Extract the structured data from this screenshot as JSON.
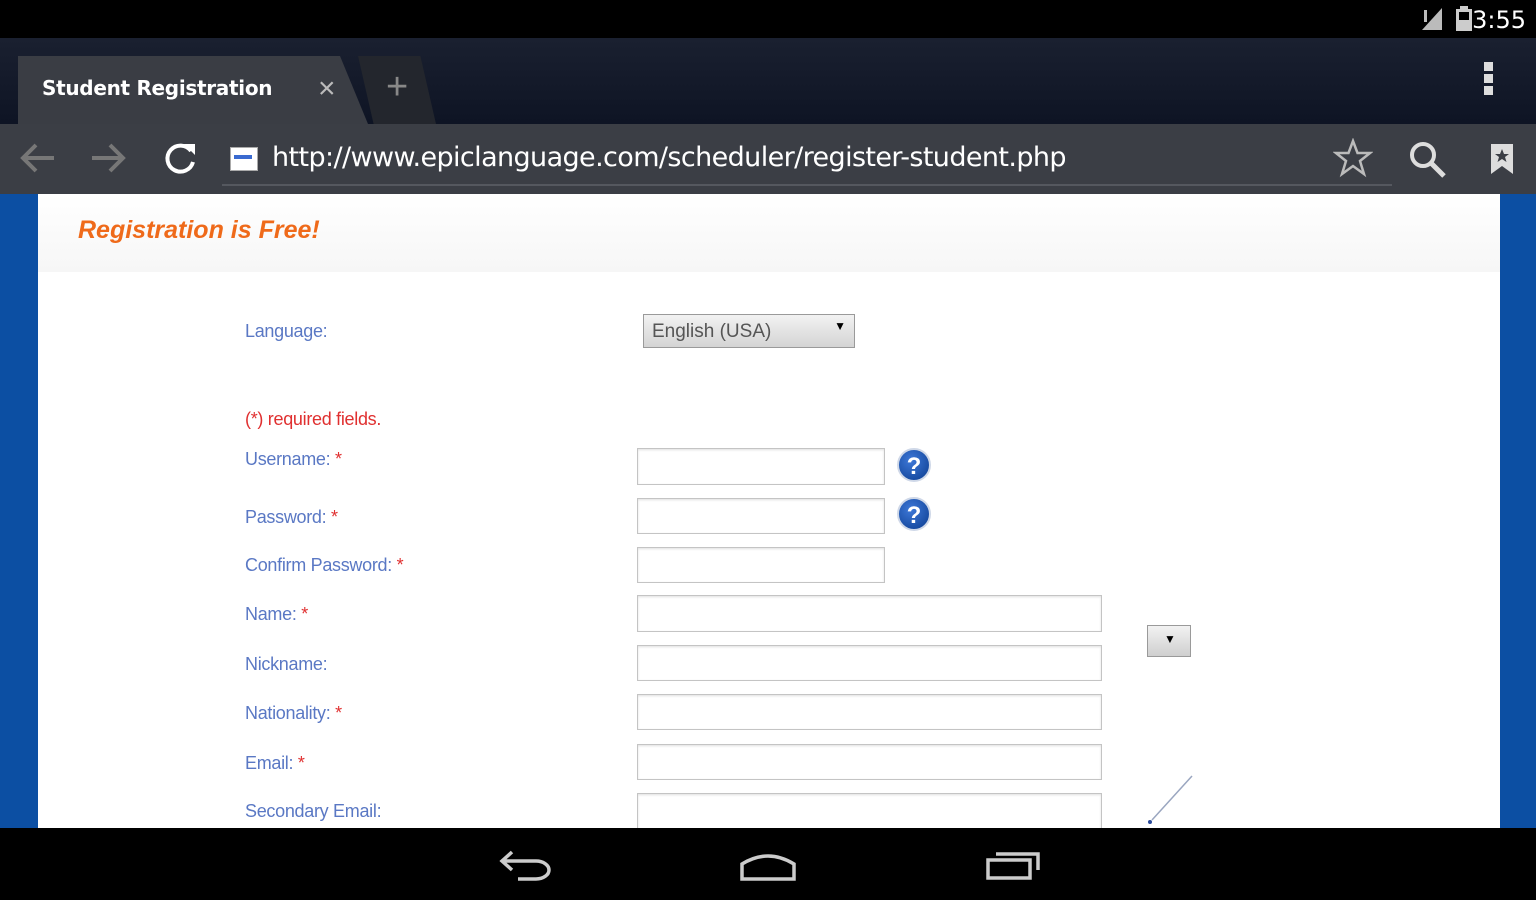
{
  "status_bar": {
    "time": "3:55"
  },
  "browser": {
    "tab_title": "Student Registration",
    "close_glyph": "×",
    "new_tab_glyph": "+",
    "url": "http://www.epiclanguage.com/scheduler/register-student.php"
  },
  "page": {
    "heading": "Registration is Free!",
    "language_label": "Language:",
    "language_value": "English (USA)",
    "required_note": "(*) required fields.",
    "fields": {
      "username": {
        "label": "Username:",
        "required": "*"
      },
      "password": {
        "label": "Password:",
        "required": "*"
      },
      "confirm_password": {
        "label": "Confirm Password:",
        "required": "*"
      },
      "name": {
        "label": "Name:",
        "required": "*"
      },
      "nickname": {
        "label": "Nickname:"
      },
      "nationality": {
        "label": "Nationality:",
        "required": "*"
      },
      "email": {
        "label": "Email:",
        "required": "*"
      },
      "secondary_email": {
        "label": "Secondary Email:"
      }
    },
    "help_glyph": "?"
  },
  "colors": {
    "heading": "#ef6a1a",
    "label": "#5a78c4",
    "required": "#e03030",
    "page_background": "#0c4fa3"
  },
  "icons": [
    "back-icon",
    "forward-icon",
    "reload-icon",
    "star-icon",
    "search-icon",
    "bookmark-icon",
    "overflow-menu-icon",
    "nav-back-icon",
    "home-icon",
    "recents-icon",
    "help-icon"
  ]
}
